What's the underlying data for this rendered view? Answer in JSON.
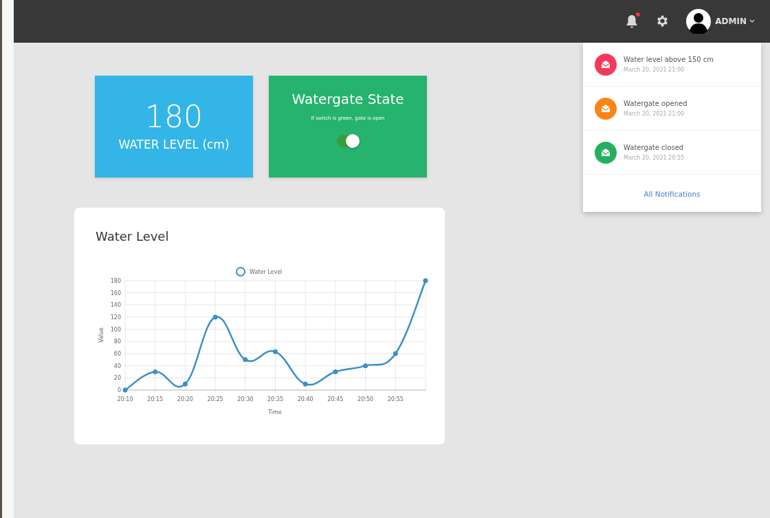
{
  "topbar": {
    "bell_badge": true,
    "user": "ADMIN"
  },
  "notifications": [
    {
      "title": "Water level above 150 cm",
      "time": "March 20, 2021 21:00",
      "color": "#f5385a"
    },
    {
      "title": "Watergate opened",
      "time": "March 20, 2021 21:00",
      "color": "#fb8514"
    },
    {
      "title": "Watergate closed",
      "time": "March 20, 2021 20:55",
      "color": "#22b060"
    }
  ],
  "all_notifications": "All Notifications",
  "level_card": {
    "value": "180",
    "label": "WATER LEVEL (cm)"
  },
  "gate_card": {
    "title": "Watergate State",
    "hint": "If switch is green, gate is open",
    "on": true
  },
  "chart_card": {
    "title": "Water Level",
    "chart_data": {
      "type": "line",
      "xlabel": "Time",
      "ylabel": "Value",
      "categories": [
        "20:10",
        "20:15",
        "20:20",
        "20:25",
        "20:30",
        "20:35",
        "20:40",
        "20:45",
        "20:50",
        "20:55",
        null
      ],
      "series": [
        {
          "name": "Water Level",
          "color": "#3a8fc8",
          "marker": true,
          "values": [
            0,
            30,
            10,
            120,
            50,
            63,
            10,
            30,
            40,
            60,
            180
          ]
        }
      ],
      "ylim": [
        0,
        180
      ],
      "grid": true,
      "yticks": [
        0,
        20,
        40,
        60,
        80,
        100,
        120,
        140,
        160,
        180
      ]
    }
  }
}
